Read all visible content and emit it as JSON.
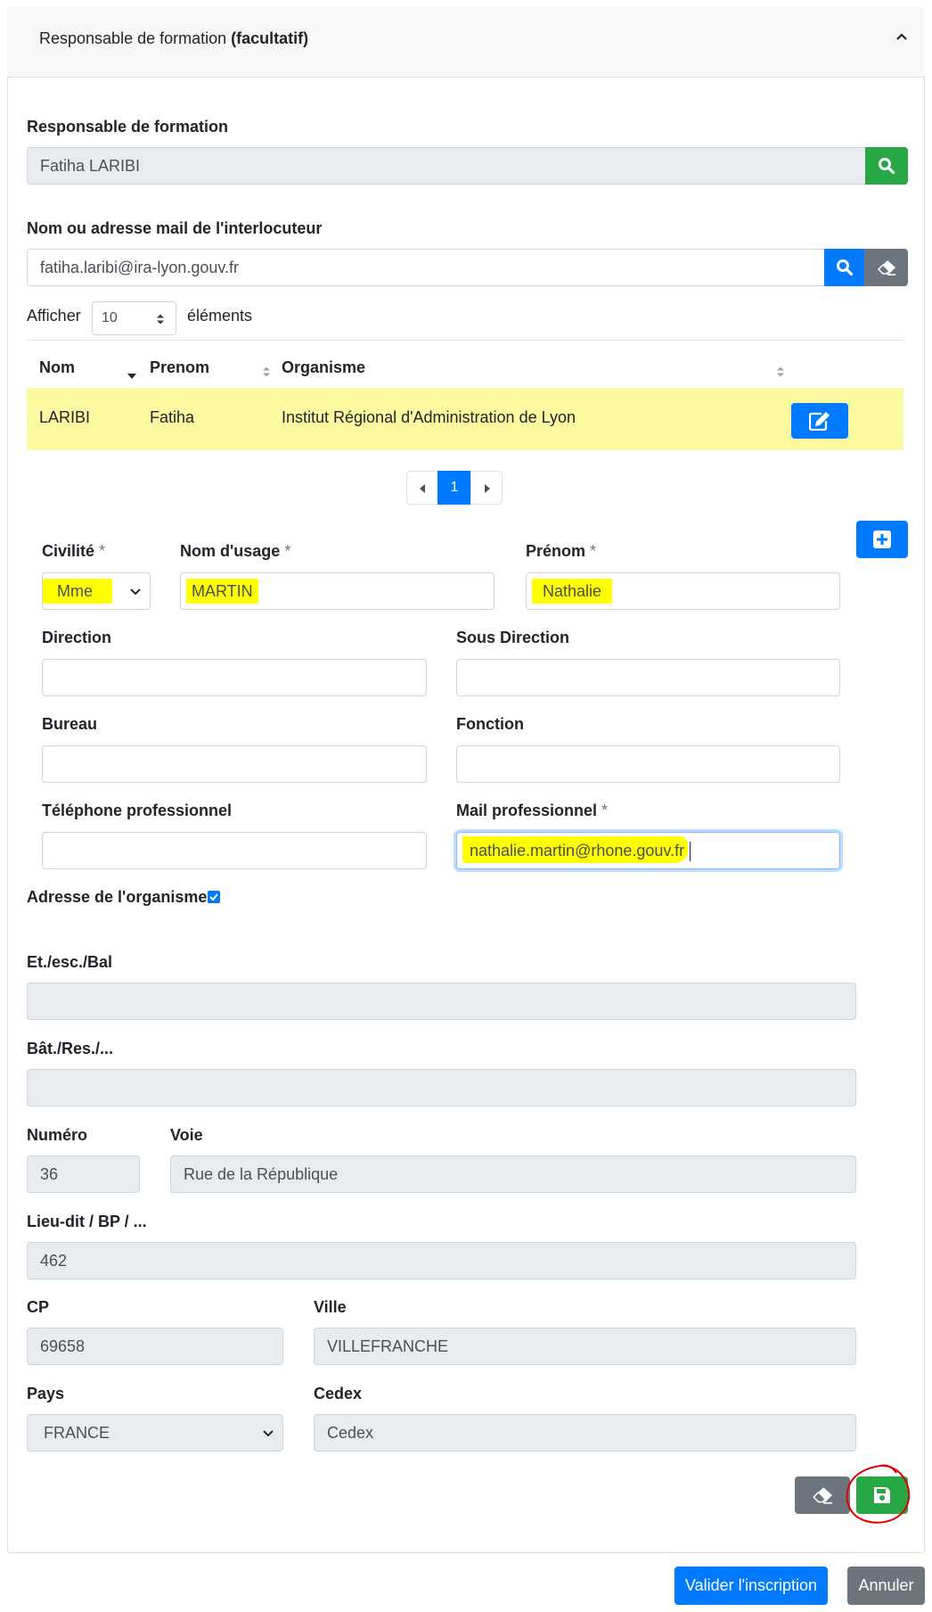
{
  "header": {
    "title_prefix": "Responsable de formation",
    "title_bold": "(facultatif)"
  },
  "responsable": {
    "label": "Responsable de formation",
    "value": "Fatiha LARIBI"
  },
  "search": {
    "label": "Nom ou adresse mail de l'interlocuteur",
    "value": "fatiha.laribi@ira-lyon.gouv.fr"
  },
  "length": {
    "prefix": "Afficher",
    "value": "10",
    "suffix": "éléments"
  },
  "table": {
    "headers": [
      "Nom",
      "Prenom",
      "Organisme"
    ],
    "rows": [
      {
        "nom": "LARIBI",
        "prenom": "Fatiha",
        "organisme": "Institut Régional d'Administration de Lyon"
      }
    ]
  },
  "pagination": {
    "current": "1"
  },
  "form": {
    "civilite": {
      "label": "Civilité",
      "value": "Mme"
    },
    "nom_usage": {
      "label": "Nom d'usage",
      "value": "MARTIN"
    },
    "prenom": {
      "label": "Prénom",
      "value": "Nathalie"
    },
    "direction": {
      "label": "Direction",
      "value": ""
    },
    "sous_direction": {
      "label": "Sous Direction",
      "value": ""
    },
    "bureau": {
      "label": "Bureau",
      "value": ""
    },
    "fonction": {
      "label": "Fonction",
      "value": ""
    },
    "telephone": {
      "label": "Téléphone professionnel",
      "value": ""
    },
    "mail": {
      "label": "Mail professionnel",
      "value": "nathalie.martin@rhone.gouv.fr"
    },
    "required_mark": "*"
  },
  "address": {
    "section_label": "Adresse de l'organisme",
    "et_esc_bal": {
      "label": "Et./esc./Bal",
      "value": ""
    },
    "bat_res": {
      "label": "Bât./Res./...",
      "value": ""
    },
    "numero": {
      "label": "Numéro",
      "value": "36"
    },
    "voie": {
      "label": "Voie",
      "value": "Rue de la République"
    },
    "lieu_dit": {
      "label": "Lieu-dit / BP / ...",
      "value": "462"
    },
    "cp": {
      "label": "CP",
      "value": "69658"
    },
    "ville": {
      "label": "Ville",
      "value": "VILLEFRANCHE"
    },
    "pays": {
      "label": "Pays",
      "value": "FRANCE"
    },
    "cedex": {
      "label": "Cedex",
      "value": "Cedex"
    }
  },
  "footer": {
    "valider": "Valider l'inscription",
    "annuler": "Annuler"
  },
  "colors": {
    "green": "#28a745",
    "blue": "#007bff",
    "gray": "#6c757d",
    "highlight": "#ffff00",
    "row_highlight": "#fcfaa0",
    "annotation": "#e00000"
  }
}
